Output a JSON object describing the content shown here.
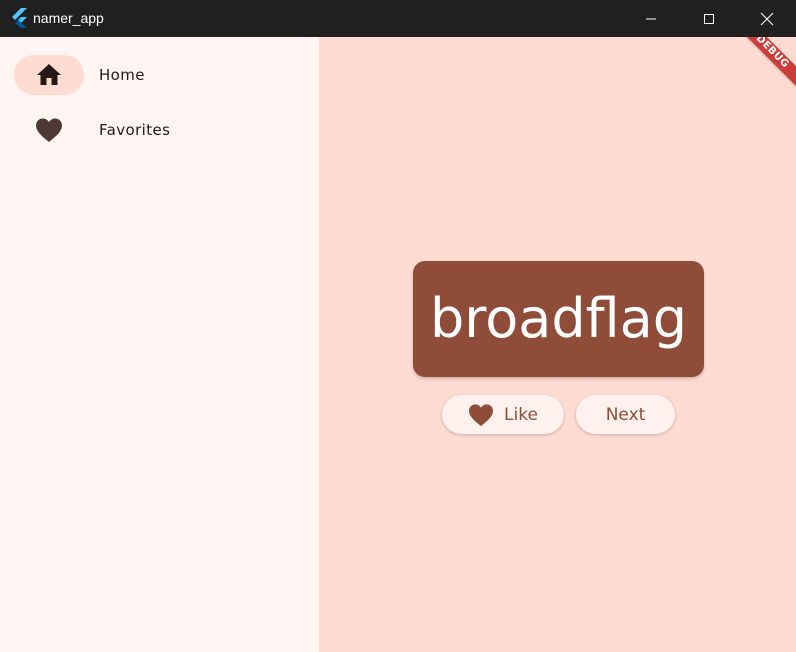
{
  "window": {
    "title": "namer_app"
  },
  "nav": {
    "items": [
      {
        "label": "Home",
        "icon": "home-icon",
        "selected": true
      },
      {
        "label": "Favorites",
        "icon": "heart-icon",
        "selected": false
      }
    ]
  },
  "main": {
    "debug_banner": "DEBUG",
    "word": "broadflag",
    "like_label": "Like",
    "next_label": "Next"
  },
  "colors": {
    "rail_bg": "#fff5f3",
    "main_bg": "#ffdbd1",
    "card_bg": "#8f4c38",
    "selected_indicator": "#ffdbd1",
    "button_bg": "#fff1ed",
    "button_text": "#8f4c38",
    "icon_dark": "#4e3a35"
  }
}
